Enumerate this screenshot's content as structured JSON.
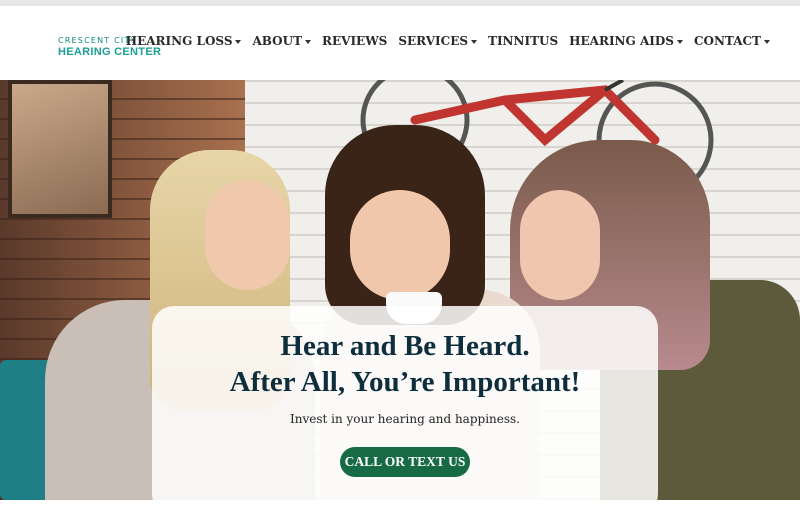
{
  "logo": {
    "small_text": "CRESCENT CITY",
    "big_text": "HEARING CENTER",
    "colors": {
      "teal": "#1a9e95",
      "dark_teal": "#0e6f6b"
    }
  },
  "nav": {
    "items": [
      {
        "label": "HEARING LOSS",
        "has_dropdown": true
      },
      {
        "label": "ABOUT",
        "has_dropdown": true
      },
      {
        "label": "REVIEWS",
        "has_dropdown": false
      },
      {
        "label": "SERVICES",
        "has_dropdown": true
      },
      {
        "label": "TINNITUS",
        "has_dropdown": false
      },
      {
        "label": "HEARING AIDS",
        "has_dropdown": true
      },
      {
        "label": "CONTACT",
        "has_dropdown": true
      }
    ]
  },
  "hero": {
    "headline_line1": "Hear and Be Heard.",
    "headline_line2": "After All, You’re Important!",
    "subtext": "Invest in your hearing and happiness.",
    "cta_label": "CALL OR TEXT US",
    "colors": {
      "headline": "#0e2d3d",
      "cta_bg": "#166b45",
      "cta_text": "#ffffff"
    }
  }
}
